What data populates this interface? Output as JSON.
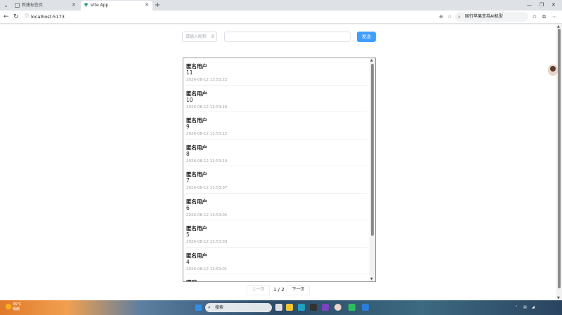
{
  "browser": {
    "tabs": [
      {
        "label": "新建标签页",
        "active": false
      },
      {
        "label": "Vite App",
        "active": true
      }
    ],
    "url": "localhost:5173",
    "search_text": "国行苹果支持AI机型"
  },
  "form": {
    "nickname_placeholder": "请输入昵称",
    "nickname_count": "0",
    "message_value": "",
    "send_label": "发送"
  },
  "messages": [
    {
      "name": "匿名用户",
      "content": "11",
      "time": "2026-08-12 13:53:22"
    },
    {
      "name": "匿名用户",
      "content": "10",
      "time": "2026-08-12 13:53:16"
    },
    {
      "name": "匿名用户",
      "content": "9",
      "time": "2026-08-12 13:53:12"
    },
    {
      "name": "匿名用户",
      "content": "8",
      "time": "2026-08-12 13:53:10"
    },
    {
      "name": "匿名用户",
      "content": "7",
      "time": "2026-08-12 13:53:07"
    },
    {
      "name": "匿名用户",
      "content": "6",
      "time": "2026-08-12 13:53:05"
    },
    {
      "name": "匿名用户",
      "content": "5",
      "time": "2026-08-12 13:53:03"
    },
    {
      "name": "匿名用户",
      "content": "4",
      "time": "2026-08-12 13:53:01"
    },
    {
      "name": "哪咤",
      "content": "",
      "time": ""
    }
  ],
  "pagination": {
    "prev_label": "上一页",
    "info": "1 / 2",
    "next_label": "下一页"
  },
  "taskbar": {
    "weather_temp": "36°C",
    "weather_desc": "晴朗",
    "search_label": "搜索"
  },
  "colors": {
    "accent": "#409eff",
    "border": "#dcdfe6"
  }
}
